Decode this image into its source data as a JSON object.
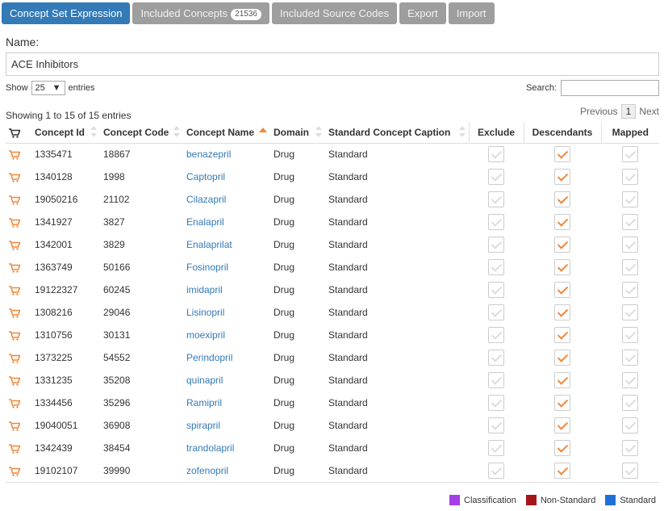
{
  "tabs": [
    {
      "label": "Concept Set Expression",
      "active": true
    },
    {
      "label": "Included Concepts",
      "badge": "21536",
      "active": false
    },
    {
      "label": "Included Source Codes",
      "active": false
    },
    {
      "label": "Export",
      "active": false
    },
    {
      "label": "Import",
      "active": false
    }
  ],
  "name": {
    "label": "Name:",
    "value": "ACE Inhibitors"
  },
  "length_menu": {
    "show": "Show",
    "value": "25",
    "entries": "entries"
  },
  "search": {
    "label": "Search:",
    "value": ""
  },
  "info": "Showing 1 to 15 of 15 entries",
  "pagination": {
    "previous": "Previous",
    "current": "1",
    "next": "Next"
  },
  "columns": [
    "Concept Id",
    "Concept Code",
    "Concept Name",
    "Domain",
    "Standard Concept Caption",
    "Exclude",
    "Descendants",
    "Mapped"
  ],
  "rows": [
    {
      "id": "1335471",
      "code": "18867",
      "name": "benazepril",
      "domain": "Drug",
      "standard": "Standard",
      "exclude": false,
      "descendants": true,
      "mapped": false
    },
    {
      "id": "1340128",
      "code": "1998",
      "name": "Captopril",
      "domain": "Drug",
      "standard": "Standard",
      "exclude": false,
      "descendants": true,
      "mapped": false
    },
    {
      "id": "19050216",
      "code": "21102",
      "name": "Cilazapril",
      "domain": "Drug",
      "standard": "Standard",
      "exclude": false,
      "descendants": true,
      "mapped": false
    },
    {
      "id": "1341927",
      "code": "3827",
      "name": "Enalapril",
      "domain": "Drug",
      "standard": "Standard",
      "exclude": false,
      "descendants": true,
      "mapped": false
    },
    {
      "id": "1342001",
      "code": "3829",
      "name": "Enalaprilat",
      "domain": "Drug",
      "standard": "Standard",
      "exclude": false,
      "descendants": true,
      "mapped": false
    },
    {
      "id": "1363749",
      "code": "50166",
      "name": "Fosinopril",
      "domain": "Drug",
      "standard": "Standard",
      "exclude": false,
      "descendants": true,
      "mapped": false
    },
    {
      "id": "19122327",
      "code": "60245",
      "name": "imidapril",
      "domain": "Drug",
      "standard": "Standard",
      "exclude": false,
      "descendants": true,
      "mapped": false
    },
    {
      "id": "1308216",
      "code": "29046",
      "name": "Lisinopril",
      "domain": "Drug",
      "standard": "Standard",
      "exclude": false,
      "descendants": true,
      "mapped": false
    },
    {
      "id": "1310756",
      "code": "30131",
      "name": "moexipril",
      "domain": "Drug",
      "standard": "Standard",
      "exclude": false,
      "descendants": true,
      "mapped": false
    },
    {
      "id": "1373225",
      "code": "54552",
      "name": "Perindopril",
      "domain": "Drug",
      "standard": "Standard",
      "exclude": false,
      "descendants": true,
      "mapped": false
    },
    {
      "id": "1331235",
      "code": "35208",
      "name": "quinapril",
      "domain": "Drug",
      "standard": "Standard",
      "exclude": false,
      "descendants": true,
      "mapped": false
    },
    {
      "id": "1334456",
      "code": "35296",
      "name": "Ramipril",
      "domain": "Drug",
      "standard": "Standard",
      "exclude": false,
      "descendants": true,
      "mapped": false
    },
    {
      "id": "19040051",
      "code": "36908",
      "name": "spirapril",
      "domain": "Drug",
      "standard": "Standard",
      "exclude": false,
      "descendants": true,
      "mapped": false
    },
    {
      "id": "1342439",
      "code": "38454",
      "name": "trandolapril",
      "domain": "Drug",
      "standard": "Standard",
      "exclude": false,
      "descendants": true,
      "mapped": false
    },
    {
      "id": "19102107",
      "code": "39990",
      "name": "zofenopril",
      "domain": "Drug",
      "standard": "Standard",
      "exclude": false,
      "descendants": true,
      "mapped": false
    }
  ],
  "legend": [
    {
      "label": "Classification",
      "color": "#a23fe8"
    },
    {
      "label": "Non-Standard",
      "color": "#a3151b"
    },
    {
      "label": "Standard",
      "color": "#1f6fd6"
    }
  ],
  "colors": {
    "accent": "#337ab7",
    "check": "#f0883a",
    "cart": "#f0883a",
    "tab_inactive": "#9e9e9e"
  },
  "icons": {
    "row": "shopping-cart-icon",
    "sort": "sort-arrows-icon",
    "check": "checkmark-icon"
  }
}
